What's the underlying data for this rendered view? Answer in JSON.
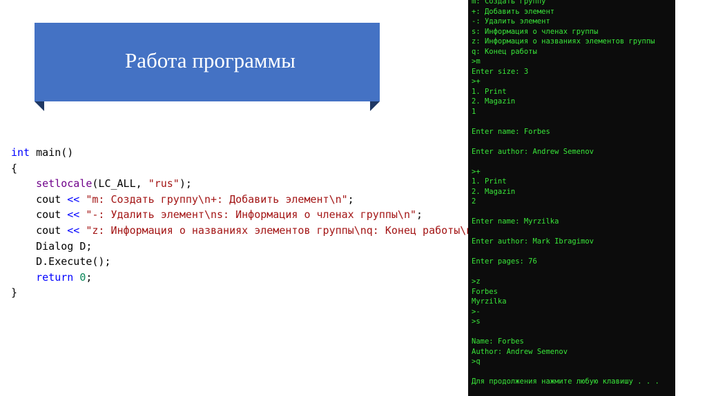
{
  "slide": {
    "title": "Работа программы"
  },
  "code": {
    "line1_kw": "int",
    "line1_rest": " main()",
    "line2": "{",
    "line3_fn": "setlocale",
    "line3_a": "(LC_ALL, ",
    "line3_str": "\"rus\"",
    "line3_b": ");",
    "cout": "cout",
    "op": "<<",
    "line4_str": "\"m: Создать группу\\n+: Добавить элемент\\n\"",
    "line5_str": "\"-: Удалить элемент\\ns: Информация о членах группы\\n\"",
    "line6_str": "\"z: Информация о названиях элементов группы\\nq: Конец работы\\n\"",
    "semi": ";",
    "line7": "Dialog D;",
    "line8": "D.Execute();",
    "line9_kw": "return",
    "line9_num": "0",
    "line10": "}"
  },
  "console": {
    "lines": [
      "m: Создать группу",
      "+: Добавить элемент",
      "-: Удалить элемент",
      "s: Информация о членах группы",
      "z: Информация о названиях элементов группы",
      "q: Конец работы",
      ">m",
      "Enter size: 3",
      ">+",
      "1. Print",
      "2. Magazin",
      "1",
      "",
      "Enter name: Forbes",
      "",
      "Enter author: Andrew Semenov",
      "",
      ">+",
      "1. Print",
      "2. Magazin",
      "2",
      "",
      "Enter name: Myrzilka",
      "",
      "Enter author: Mark Ibragimov",
      "",
      "Enter pages: 76",
      "",
      ">z",
      "Forbes",
      "Myrzilka",
      ">-",
      ">s",
      "",
      "Name: Forbes",
      "Author: Andrew Semenov",
      ">q",
      "",
      "Для продолжения нажмите любую клавишу . . ."
    ]
  },
  "colors": {
    "banner": "#4472c4",
    "banner_fold": "#1f3864",
    "console_bg": "#0c0c0c",
    "console_text": "#39e639",
    "keyword": "#0000ff",
    "function": "#6f008a",
    "string": "#a31515",
    "number": "#098658"
  }
}
